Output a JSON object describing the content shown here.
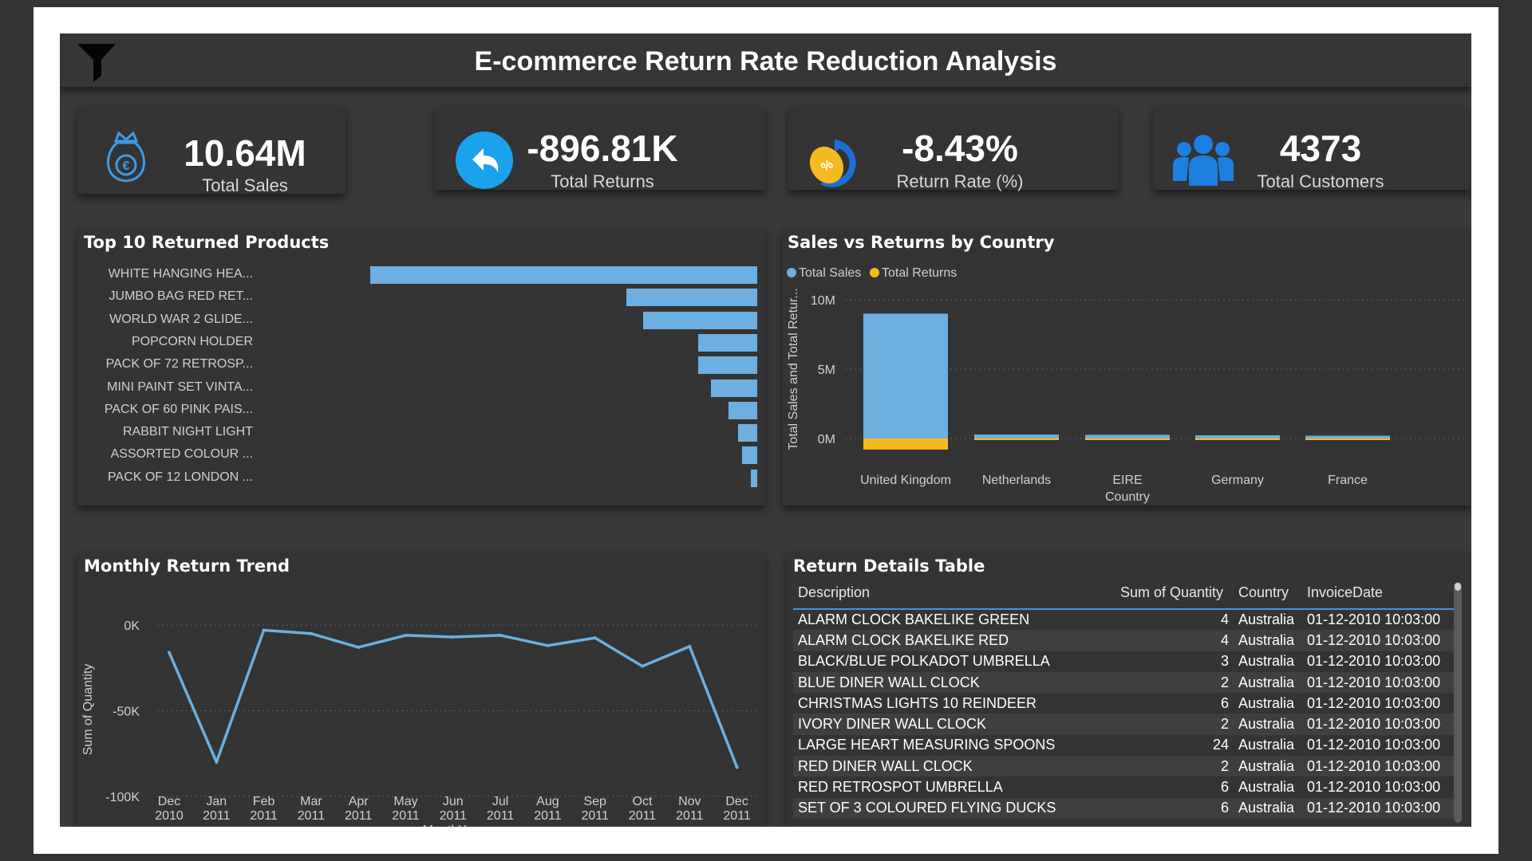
{
  "title": "E-commerce Return Rate Reduction Analysis",
  "kpis": {
    "sales": {
      "value": "10.64M",
      "label": "Total Sales",
      "icon": "money-bag-euro-icon"
    },
    "returns": {
      "value": "-896.81K",
      "label": "Total Returns",
      "icon": "return-arrow-icon"
    },
    "rate": {
      "value": "-8.43%",
      "label": "Return Rate (%)",
      "icon": "percent-refresh-icon"
    },
    "customers": {
      "value": "4373",
      "label": "Total Customers",
      "icon": "people-group-icon"
    }
  },
  "top_products": {
    "title": "Top 10 Returned Products",
    "items": [
      {
        "label": "WHITE HANGING HEA..."
      },
      {
        "label": "JUMBO BAG RED RET..."
      },
      {
        "label": "WORLD WAR 2 GLIDE..."
      },
      {
        "label": "POPCORN HOLDER"
      },
      {
        "label": "PACK OF 72 RETROSP..."
      },
      {
        "label": "MINI PAINT SET VINTA..."
      },
      {
        "label": "PACK OF 60 PINK PAIS..."
      },
      {
        "label": "RABBIT NIGHT LIGHT"
      },
      {
        "label": "ASSORTED COLOUR ..."
      },
      {
        "label": "PACK OF 12 LONDON ..."
      }
    ]
  },
  "country_chart": {
    "title": "Sales vs Returns by Country",
    "legend": [
      "Total Sales",
      "Total Returns"
    ],
    "ylabel": "Total Sales and Total Retur...",
    "xlabel": "Country",
    "yticks": [
      "10M",
      "5M",
      "0M"
    ]
  },
  "trend_chart": {
    "title": "Monthly Return Trend",
    "ylabel": "Sum of Quantity",
    "xlabel": "MonthYear",
    "yticks": [
      "0K",
      "-50K",
      "-100K"
    ]
  },
  "table": {
    "title": "Return Details Table",
    "columns": [
      "Description",
      "Sum of Quantity",
      "Country",
      "InvoiceDate"
    ],
    "rows": [
      [
        "ALARM CLOCK BAKELIKE GREEN",
        "4",
        "Australia",
        "01-12-2010 10:03:00"
      ],
      [
        "ALARM CLOCK BAKELIKE RED",
        "4",
        "Australia",
        "01-12-2010 10:03:00"
      ],
      [
        "BLACK/BLUE POLKADOT UMBRELLA",
        "3",
        "Australia",
        "01-12-2010 10:03:00"
      ],
      [
        "BLUE DINER WALL CLOCK",
        "2",
        "Australia",
        "01-12-2010 10:03:00"
      ],
      [
        "CHRISTMAS LIGHTS 10 REINDEER",
        "6",
        "Australia",
        "01-12-2010 10:03:00"
      ],
      [
        "IVORY DINER WALL CLOCK",
        "2",
        "Australia",
        "01-12-2010 10:03:00"
      ],
      [
        "LARGE HEART MEASURING SPOONS",
        "24",
        "Australia",
        "01-12-2010 10:03:00"
      ],
      [
        "RED DINER WALL CLOCK",
        "2",
        "Australia",
        "01-12-2010 10:03:00"
      ],
      [
        "RED RETROSPOT UMBRELLA",
        "6",
        "Australia",
        "01-12-2010 10:03:00"
      ],
      [
        "SET OF 3 COLOURED FLYING DUCKS",
        "6",
        "Australia",
        "01-12-2010 10:03:00"
      ]
    ]
  },
  "colors": {
    "sales": "#6cafe0",
    "returns": "#f5b921",
    "accent": "#1e90ff"
  },
  "chart_data": [
    {
      "type": "bar",
      "title": "Top 10 Returned Products",
      "orientation": "horizontal",
      "categories": [
        "WHITE HANGING HEA...",
        "JUMBO BAG RED RET...",
        "WORLD WAR 2 GLIDE...",
        "POPCORN HOLDER",
        "PACK OF 72 RETROSP...",
        "MINI PAINT SET VINTA...",
        "PACK OF 60 PINK PAIS...",
        "RABBIT NIGHT LIGHT",
        "ASSORTED COLOUR ...",
        "PACK OF 12 LONDON ..."
      ],
      "values": [
        -485,
        -164,
        -143,
        -74,
        -74,
        -58,
        -36,
        -24,
        -19,
        -8
      ]
    },
    {
      "type": "bar",
      "title": "Sales vs Returns by Country",
      "categories": [
        "United Kingdom",
        "Netherlands",
        "EIRE",
        "Germany",
        "France"
      ],
      "series": [
        {
          "name": "Total Sales",
          "values": [
            9000000,
            285000,
            265000,
            230000,
            200000
          ]
        },
        {
          "name": "Total Returns",
          "values": [
            -800000,
            -5000,
            -8000,
            -8000,
            -6000
          ]
        }
      ],
      "xlabel": "Country",
      "ylabel": "Total Sales and Total Retur...",
      "ylim": [
        -1000000,
        10000000
      ],
      "legend": "top-left",
      "grid": true
    },
    {
      "type": "line",
      "title": "Monthly Return Trend",
      "x": [
        "Dec 2010",
        "Jan 2011",
        "Feb 2011",
        "Mar 2011",
        "Apr 2011",
        "May 2011",
        "Jun 2011",
        "Jul 2011",
        "Aug 2011",
        "Sep 2011",
        "Oct 2011",
        "Nov 2011",
        "Dec 2011"
      ],
      "series": [
        {
          "values": [
            -16000,
            -80000,
            -3000,
            -5000,
            -13000,
            -6000,
            -7000,
            -6000,
            -12000,
            -7500,
            -24000,
            -12500,
            -83000
          ]
        }
      ],
      "xlabel": "MonthYear",
      "ylabel": "Sum of Quantity",
      "ylim": [
        -100000,
        0
      ],
      "grid": true
    }
  ]
}
